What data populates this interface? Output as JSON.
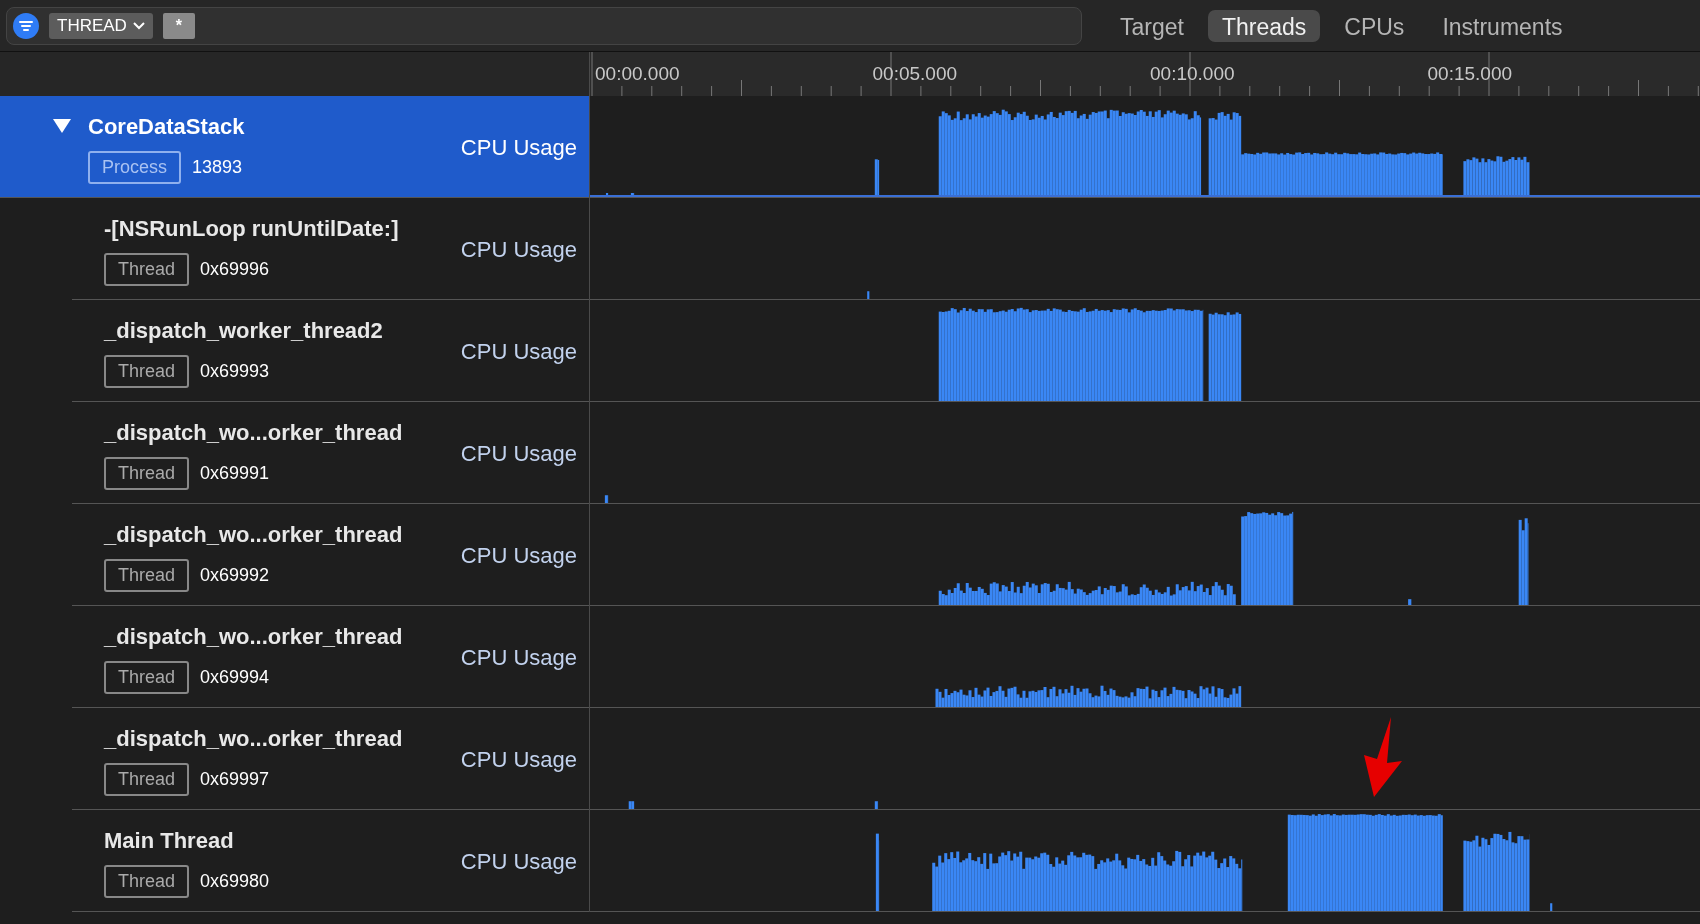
{
  "toolbar": {
    "scope": "THREAD",
    "token": "*"
  },
  "tabs": [
    {
      "label": "Target",
      "selected": false
    },
    {
      "label": "Threads",
      "selected": true
    },
    {
      "label": "CPUs",
      "selected": false
    },
    {
      "label": "Instruments",
      "selected": false
    }
  ],
  "ruler": {
    "labels": [
      "00:00.000",
      "00:05.000",
      "00:10.000",
      "00:15.000"
    ]
  },
  "process": {
    "name": "CoreDataStack",
    "tag": "Process",
    "id": "13893",
    "track": "CPU Usage",
    "selected": true,
    "expanded": true,
    "children": [
      {
        "name": "-[NSRunLoop runUntilDate:]",
        "tag": "Thread",
        "id": "0x69996",
        "track": "CPU Usage",
        "selected": false
      },
      {
        "name": "_dispatch_worker_thread2",
        "tag": "Thread",
        "id": "0x69993",
        "track": "CPU Usage",
        "selected": false
      },
      {
        "name": "_dispatch_wo...orker_thread",
        "tag": "Thread",
        "id": "0x69991",
        "track": "CPU Usage",
        "selected": false
      },
      {
        "name": "_dispatch_wo...orker_thread",
        "tag": "Thread",
        "id": "0x69992",
        "track": "CPU Usage",
        "selected": false
      },
      {
        "name": "_dispatch_wo...orker_thread",
        "tag": "Thread",
        "id": "0x69994",
        "track": "CPU Usage",
        "selected": false
      },
      {
        "name": "_dispatch_wo...orker_thread",
        "tag": "Thread",
        "id": "0x69997",
        "track": "CPU Usage",
        "selected": false
      },
      {
        "name": "Main Thread",
        "tag": "Thread",
        "id": "0x69980",
        "track": "CPU Usage",
        "selected": false
      }
    ]
  }
}
